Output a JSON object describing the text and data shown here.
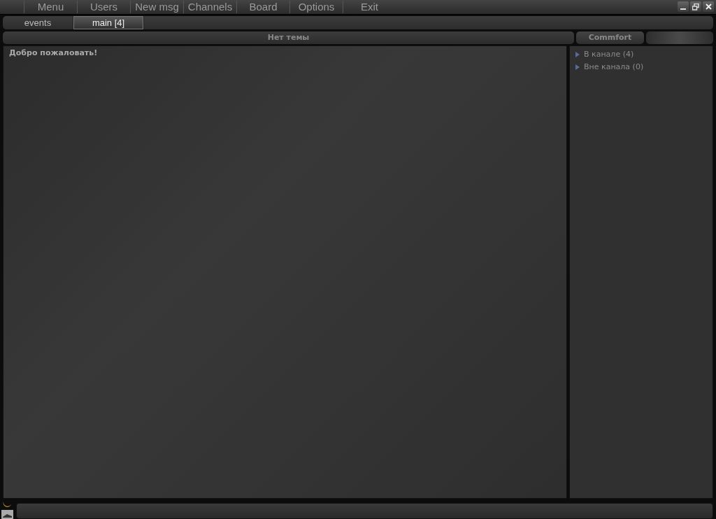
{
  "menu": [
    "Menu",
    "Users",
    "New msg",
    "Channels",
    "Board",
    "Options",
    "Exit"
  ],
  "tabs": [
    {
      "label": "events",
      "selected": false
    },
    {
      "label": "main [4]",
      "selected": true
    }
  ],
  "topic": "Нет темы",
  "messages": [
    "Добро пожаловать!"
  ],
  "sidebar": {
    "title": "Commfort",
    "groups": [
      {
        "label": "В канале (4)",
        "expanded": false
      },
      {
        "label": "Вне канала (0)",
        "expanded": false
      }
    ]
  }
}
